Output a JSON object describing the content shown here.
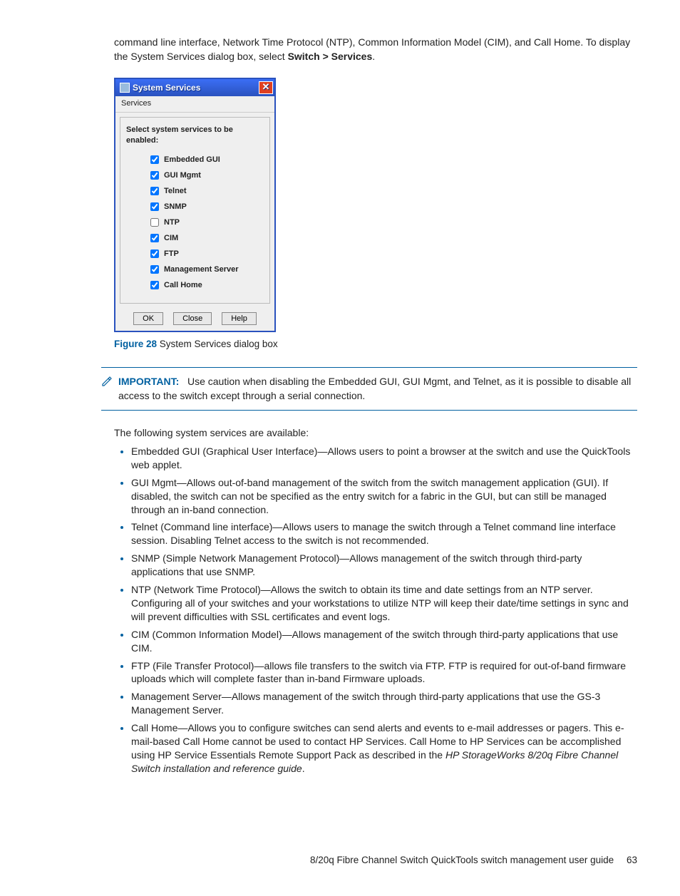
{
  "intro": {
    "line1": "command line interface, Network Time Protocol (NTP), Common Information Model (CIM), and Call Home. To display the System Services dialog box, select ",
    "bold1": "Switch > Services",
    "period": "."
  },
  "dialog": {
    "title": "System Services",
    "menu": "Services",
    "heading": "Select system services to be enabled:",
    "items": [
      {
        "label": "Embedded GUI",
        "checked": true
      },
      {
        "label": "GUI Mgmt",
        "checked": true
      },
      {
        "label": "Telnet",
        "checked": true
      },
      {
        "label": "SNMP",
        "checked": true
      },
      {
        "label": "NTP",
        "checked": false
      },
      {
        "label": "CIM",
        "checked": true
      },
      {
        "label": "FTP",
        "checked": true
      },
      {
        "label": "Management Server",
        "checked": true
      },
      {
        "label": "Call Home",
        "checked": true
      }
    ],
    "buttons": {
      "ok": "OK",
      "close": "Close",
      "help": "Help"
    }
  },
  "figure": {
    "label": "Figure 28",
    "caption": " System Services dialog box"
  },
  "important": {
    "label": "IMPORTANT:",
    "text": "Use caution when disabling the Embedded GUI, GUI Mgmt, and Telnet, as it is possible to disable all access to the switch except through a serial connection."
  },
  "available_intro": "The following system services are available:",
  "services": [
    "Embedded GUI (Graphical User Interface)—Allows users to point a browser at the switch and use the QuickTools web applet.",
    "GUI Mgmt—Allows out-of-band management of the switch from the switch management application (GUI). If disabled, the switch can not be specified as the entry switch for a fabric in the GUI, but can still be managed through an in-band connection.",
    "Telnet (Command line interface)—Allows users to manage the switch through a Telnet command line interface session. Disabling Telnet access to the switch is not recommended.",
    "SNMP (Simple Network Management Protocol)—Allows management of the switch through third-party applications that use SNMP.",
    "NTP (Network Time Protocol)—Allows the switch to obtain its time and date settings from an NTP server. Configuring all of your switches and your workstations to utilize NTP will keep their date/time settings in sync and will prevent difficulties with SSL certificates and event logs.",
    "CIM (Common Information Model)—Allows management of the switch through third-party applications that use CIM.",
    "FTP (File Transfer Protocol)—allows file transfers to the switch via FTP. FTP is required for out-of-band firmware uploads which will complete faster than in-band Firmware uploads.",
    "Management Server—Allows management of the switch through third-party applications that use the GS-3 Management Server."
  ],
  "callhome": {
    "pre": "Call Home—Allows you to configure switches can send alerts and events to e-mail addresses or pagers. This e-mail-based Call Home cannot be used to contact HP Services. Call Home to HP Services can be accomplished using HP Service Essentials Remote Support Pack as described in the ",
    "italic": "HP StorageWorks 8/20q Fibre Channel Switch installation and reference guide",
    "post": "."
  },
  "footer": {
    "text": "8/20q Fibre Channel Switch QuickTools switch management user guide",
    "page": "63"
  }
}
